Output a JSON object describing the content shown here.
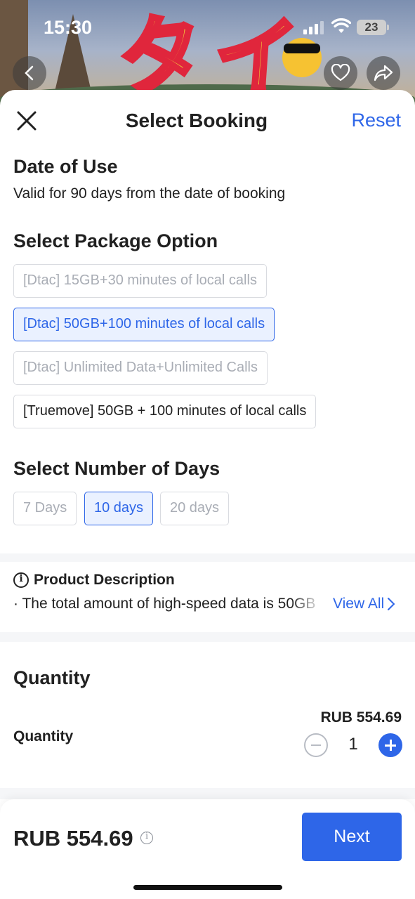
{
  "status_bar": {
    "time": "15:30",
    "battery": "23"
  },
  "sheet": {
    "title": "Select Booking",
    "reset_label": "Reset"
  },
  "date_of_use": {
    "title": "Date of Use",
    "subtitle": "Valid for 90 days from the date of booking"
  },
  "package": {
    "title": "Select Package Option",
    "options": [
      {
        "label": "[Dtac] 15GB+30 minutes of local calls",
        "state": "disabled"
      },
      {
        "label": "[Dtac] 50GB+100 minutes of local calls",
        "state": "selected"
      },
      {
        "label": "[Dtac] Unlimited Data+Unlimited Calls",
        "state": "disabled"
      },
      {
        "label": "[Truemove] 50GB + 100 minutes of local calls",
        "state": "available"
      }
    ]
  },
  "days": {
    "title": "Select Number of Days",
    "options": [
      {
        "label": "7 Days",
        "state": "disabled"
      },
      {
        "label": "10 days",
        "state": "selected"
      },
      {
        "label": "20 days",
        "state": "disabled"
      }
    ]
  },
  "description": {
    "title": "Product Description",
    "text": "· The total amount of high-speed data is 50GB",
    "view_all": "View All"
  },
  "quantity": {
    "heading": "Quantity",
    "label": "Quantity",
    "unit_price": "RUB 554.69",
    "value": "1"
  },
  "footer": {
    "total": "RUB 554.69",
    "next_label": "Next"
  },
  "colors": {
    "accent": "#2e66e8",
    "selected_bg": "#eaf1ff",
    "text": "#212121",
    "disabled_text": "#a9adb5"
  },
  "icons": [
    "back-icon",
    "heart-icon",
    "share-icon",
    "close-icon",
    "info-icon",
    "chevron-right-icon",
    "minus-icon",
    "plus-icon"
  ]
}
